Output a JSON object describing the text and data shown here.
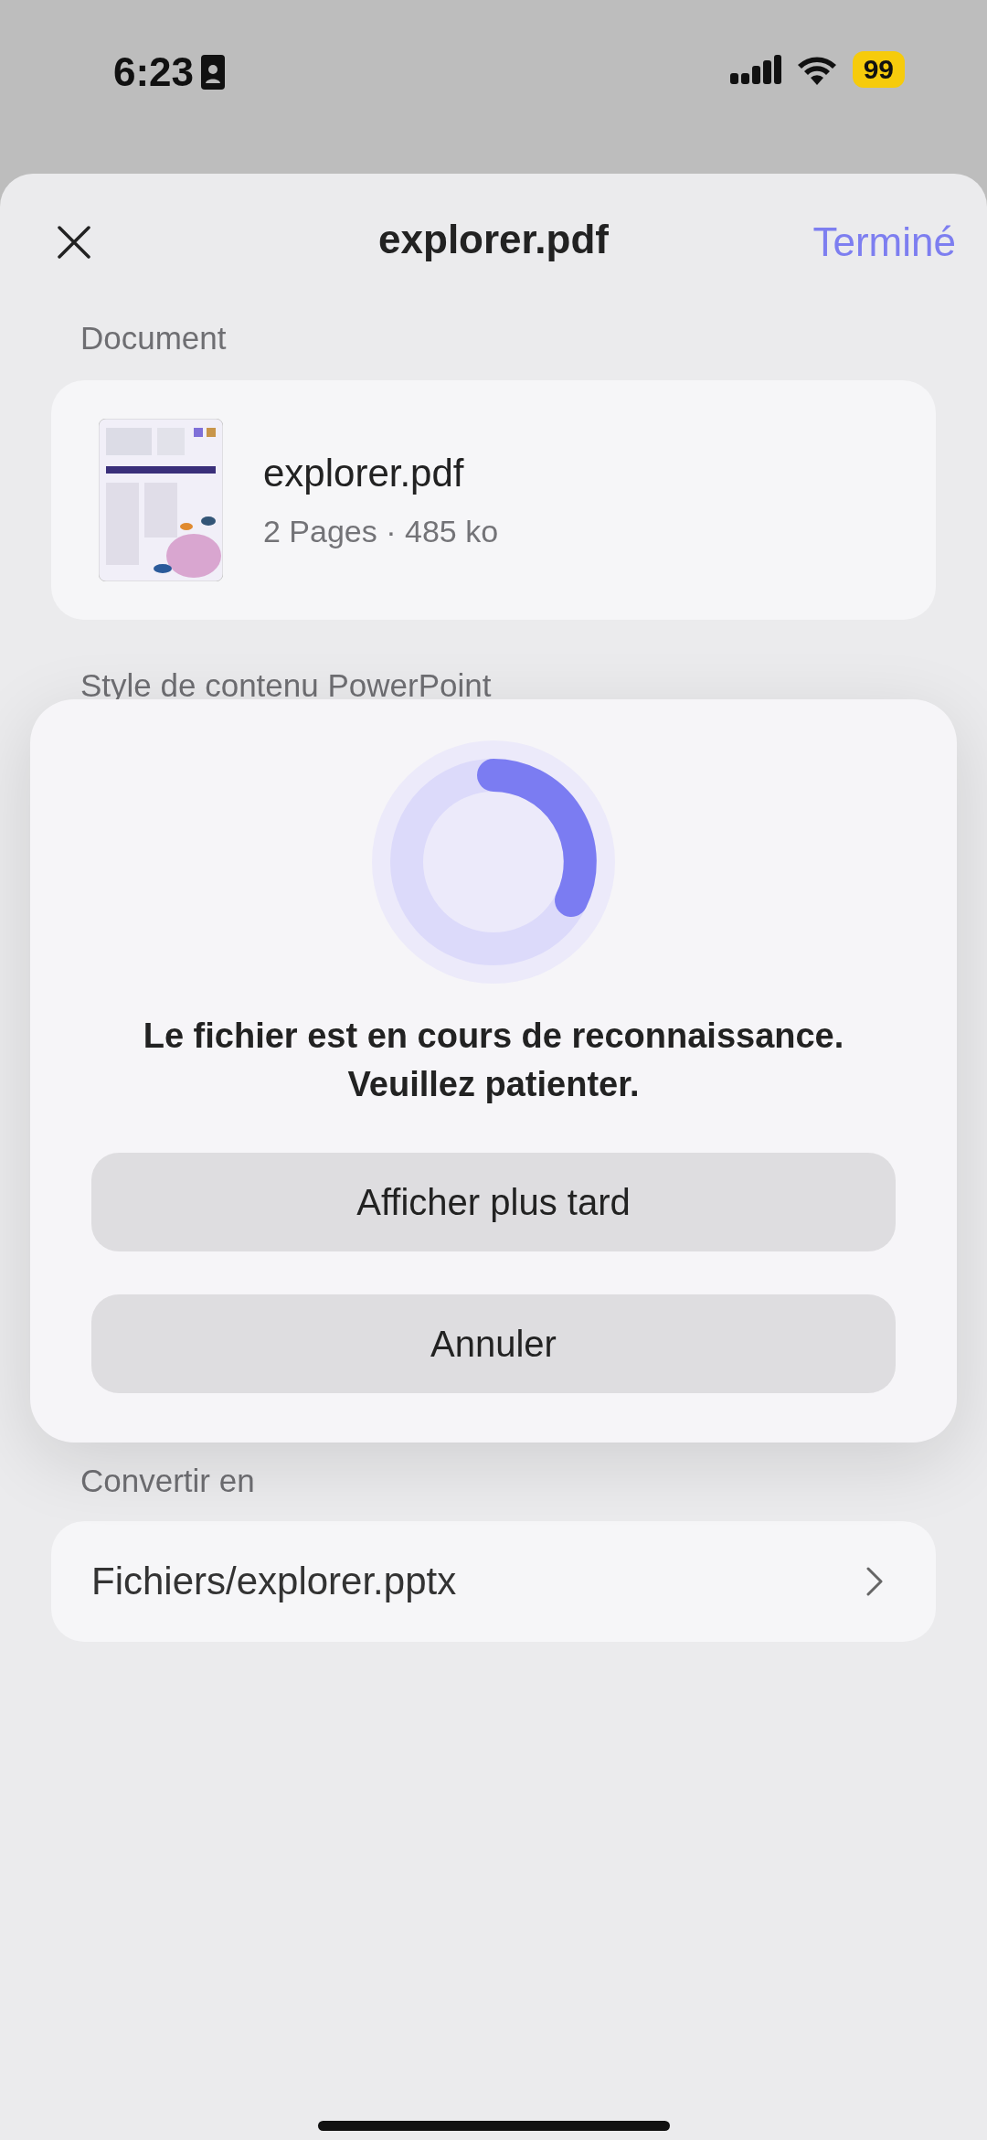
{
  "status_bar": {
    "time": "6:23",
    "battery": "99"
  },
  "header": {
    "title": "explorer.pdf",
    "done": "Terminé"
  },
  "document": {
    "label": "Document",
    "file_name": "explorer.pdf",
    "meta": "2 Pages · 485 ko"
  },
  "style_label": "Style de contenu PowerPoint",
  "dialog": {
    "message": [
      "Le fichier est en cours de reconnaissance.",
      "Veuillez patienter."
    ],
    "buttons": [
      "Afficher plus tard",
      "Annuler"
    ]
  },
  "convert": {
    "label": "Convertir en",
    "path": "Fichiers/explorer.pptx"
  }
}
